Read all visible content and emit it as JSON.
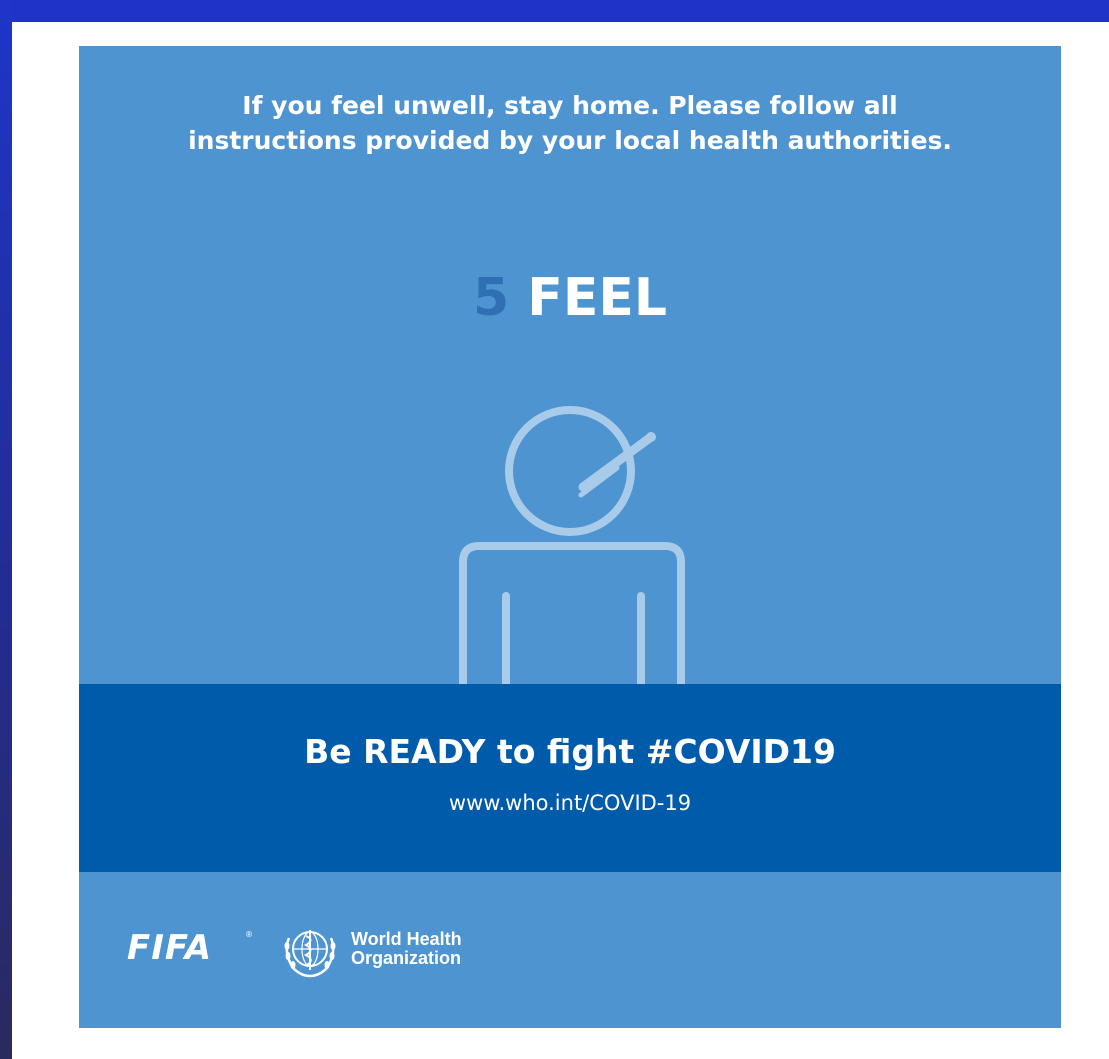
{
  "poster": {
    "headline": "If you feel unwell, stay home. Please follow all instructions provided by your local health authorities.",
    "step_number": "5",
    "step_word": "FEEL",
    "figure_icon": "person-with-thermometer-icon",
    "banner_title": "Be READY to fight #COVID19",
    "banner_url": "www.who.int/COVID-19"
  },
  "logos": {
    "fifa": "FIFA",
    "fifa_registered": "®",
    "who_line1": "World Health",
    "who_line2": "Organization",
    "who_emblem_icon": "who-emblem-icon"
  },
  "colors": {
    "card_background": "#4d94d0",
    "banner_background": "#005baa",
    "step_number": "#2f6fb3",
    "frame_accent": "#1f33c9",
    "icon_stroke": "#a9cbea"
  }
}
